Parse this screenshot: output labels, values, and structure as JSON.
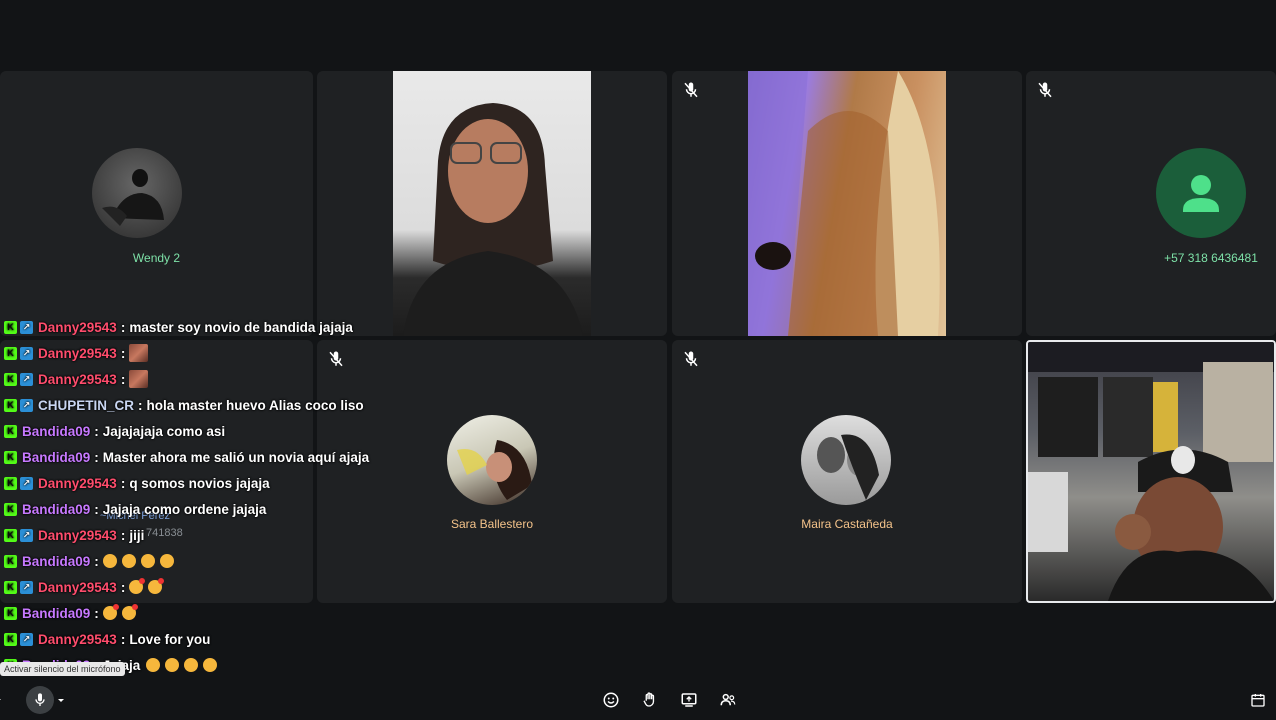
{
  "participants": {
    "wendy": {
      "name": "Wendy 2",
      "color": "#7ee2a8"
    },
    "phone": {
      "name": "+57 318 6436481",
      "color": "#7ee2a8"
    },
    "sara": {
      "name": "Sara Ballestero",
      "color": "#f4c38a"
    },
    "maira": {
      "name": "Maira Castañeda",
      "color": "#f4c38a"
    }
  },
  "ghost": {
    "name": "~Michel Perez",
    "number": "741838"
  },
  "tooltip": "Activar silencio del micrófono",
  "chat": [
    {
      "badges": [
        "k",
        "up"
      ],
      "user": "Danny29543",
      "color": "#ff4d6d",
      "text": "master soy novio de bandida jajaja"
    },
    {
      "badges": [
        "k",
        "up"
      ],
      "user": "Danny29543",
      "color": "#ff4d6d",
      "text": "",
      "sticker": true
    },
    {
      "badges": [
        "k",
        "up"
      ],
      "user": "Danny29543",
      "color": "#ff4d6d",
      "text": "",
      "sticker": true
    },
    {
      "badges": [
        "k",
        "up"
      ],
      "user": "CHUPETIN_CR",
      "color": "#c9d6f2",
      "text": "hola master huevo Alias coco liso"
    },
    {
      "badges": [
        "k"
      ],
      "user": "Bandida09",
      "color": "#c779ff",
      "text": "Jajajajaja como asi"
    },
    {
      "badges": [
        "k"
      ],
      "user": "Bandida09",
      "color": "#c779ff",
      "text": "Master ahora me salió un novia aquí ajaja"
    },
    {
      "badges": [
        "k",
        "up"
      ],
      "user": "Danny29543",
      "color": "#ff4d6d",
      "text": "q somos novios jajaja"
    },
    {
      "badges": [
        "k"
      ],
      "user": "Bandida09",
      "color": "#c779ff",
      "text": "Jajaja como ordene jajaja"
    },
    {
      "badges": [
        "k",
        "up"
      ],
      "user": "Danny29543",
      "color": "#ff4d6d",
      "text": "jiji"
    },
    {
      "badges": [
        "k"
      ],
      "user": "Bandida09",
      "color": "#c779ff",
      "text": "",
      "emojis": 4,
      "emojiType": "heart"
    },
    {
      "badges": [
        "k",
        "up"
      ],
      "user": "Danny29543",
      "color": "#ff4d6d",
      "text": "",
      "emojis": 2,
      "emojiType": "kiss"
    },
    {
      "badges": [
        "k"
      ],
      "user": "Bandida09",
      "color": "#c779ff",
      "text": "",
      "emojis": 2,
      "emojiType": "kiss"
    },
    {
      "badges": [
        "k",
        "up"
      ],
      "user": "Danny29543",
      "color": "#ff4d6d",
      "text": "Love for you"
    },
    {
      "badges": [
        "k"
      ],
      "user": "Bandida09",
      "color": "#c779ff",
      "text": "Jajaja",
      "emojis": 4,
      "emojiType": "laugh"
    }
  ]
}
